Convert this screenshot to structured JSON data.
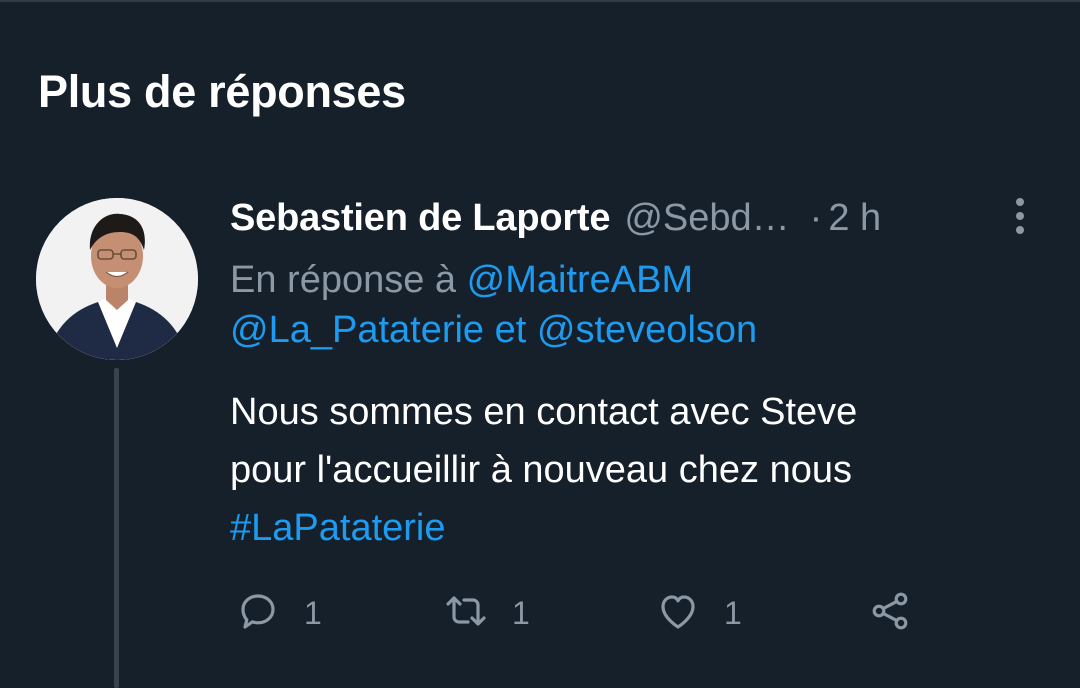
{
  "section": {
    "title": "Plus de réponses"
  },
  "tweet": {
    "author_name": "Sebastien de Laporte",
    "author_handle": "@Sebd…",
    "separator": "·",
    "time": "2 h",
    "reply_prefix": "En réponse à",
    "reply_mentions": [
      "@MaitreABM",
      "@La_Pataterie",
      "@steveolson"
    ],
    "reply_joiner": "et",
    "body_lines": [
      "Nous sommes en contact avec Steve",
      "pour l'accueillir à nouveau chez nous"
    ],
    "hashtag": "#LaPataterie",
    "counts": {
      "replies": "1",
      "retweets": "1",
      "likes": "1"
    }
  },
  "icons": {
    "reply": "comment-bubble-icon",
    "retweet": "retweet-arrows-icon",
    "like": "heart-icon",
    "share": "share-nodes-icon",
    "more": "vertical-dots-icon"
  },
  "colors": {
    "background": "#15202b",
    "text_primary": "#ffffff",
    "text_secondary": "#8b98a5",
    "accent": "#1d9bf0",
    "thread_line": "#38444d"
  }
}
